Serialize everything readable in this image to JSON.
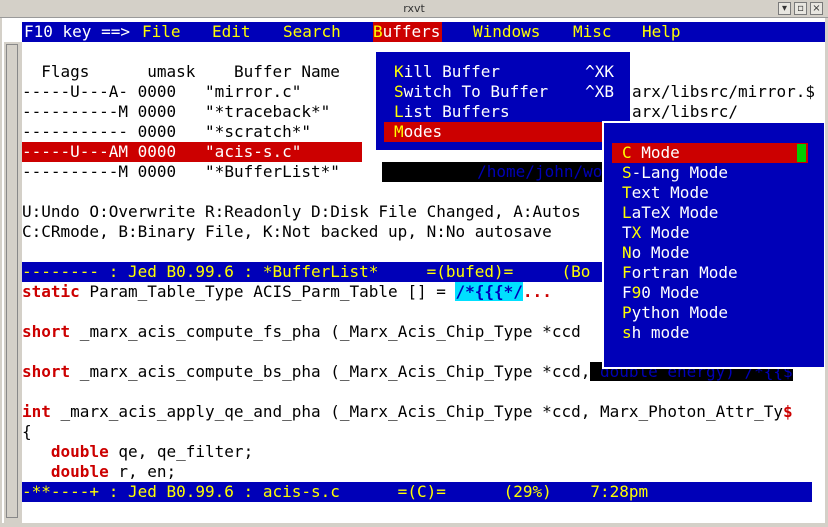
{
  "window": {
    "title": "rxvt"
  },
  "menubar": {
    "prefix": "F10 key ==>",
    "items": [
      {
        "label": "File",
        "hot": "F",
        "rest": "ile"
      },
      {
        "label": "Edit",
        "hot": "E",
        "rest": "dit"
      },
      {
        "label": "Search",
        "hot": "S",
        "rest": "earch"
      },
      {
        "label": "Buffers",
        "hot": "B",
        "rest": "uffers"
      },
      {
        "label": "Windows",
        "hot": "W",
        "rest": "indows"
      },
      {
        "label": "Misc",
        "hot": "M",
        "rest": "isc"
      },
      {
        "label": "Help",
        "hot": "H",
        "rest": "elp"
      }
    ]
  },
  "buffer_list": {
    "headers": {
      "flags": "Flags",
      "umask": "umask",
      "name": "Buffer Name"
    },
    "rows": [
      {
        "flags": "-----U---A-",
        "umask": "0000",
        "name": "\"mirror.c\"",
        "path": "arx/libsrc/mirror.$"
      },
      {
        "flags": "----------M",
        "umask": "0000",
        "name": "\"*traceback*\"",
        "path": "arx/libsrc/"
      },
      {
        "flags": "-----------",
        "umask": "0000",
        "name": "\"*scratch*\"",
        "path": ""
      },
      {
        "flags": "-----U---AM",
        "umask": "0000",
        "name": "\"acis-s.c\"",
        "path": ""
      },
      {
        "flags": "----------M",
        "umask": "0000",
        "name": "\"*BufferList*\"",
        "path": "/home/john/wor"
      }
    ],
    "legend1": "U:Undo O:Overwrite R:Readonly D:Disk File Changed, A:Autos",
    "legend2": "C:CRmode, B:Binary File, K:Not backed up, N:No autosave"
  },
  "status1": "-------- : Jed B0.99.6 : *BufferList*     =(bufed)=     (Bo",
  "code": {
    "line1_kw": "static",
    "line1_rest": " Param_Table_Type ACIS_Parm_Table [] = ",
    "line1_comment": "/*{{{*/",
    "line1_tail": "...",
    "line2_kw": "short",
    "line2_rest": " _marx_acis_compute_fs_pha (_Marx_Acis_Chip_Type *ccd",
    "line3_kw": "short",
    "line3_rest": " _marx_acis_compute_bs_pha (_Marx_Acis_Chip_Type *ccd,",
    "line3_dark": " double energy) /*{{$",
    "line4_kw": "int",
    "line4_rest": " _marx_acis_apply_qe_and_pha (_Marx_Acis_Chip_Type *ccd, Marx_Photon_Attr_Ty",
    "line4_end": "$",
    "line5": "{",
    "line6_kw": "double",
    "line6_rest": " qe, qe_filter;",
    "line7_kw": "double",
    "line7_rest": " r, en;"
  },
  "status2": "-**----+ : Jed B0.99.6 : acis-s.c      =(C)=      (29%)    7:28pm",
  "buffers_menu": {
    "items": [
      {
        "hot": "K",
        "rest": "ill Buffer",
        "key": "^XK"
      },
      {
        "hot": "S",
        "rest": "witch To Buffer",
        "key": "^XB"
      },
      {
        "hot": "L",
        "rest": "ist Buffers",
        "key": ""
      },
      {
        "hot": "M",
        "rest": "odes",
        "key": ">"
      }
    ]
  },
  "modes_menu": {
    "items": [
      {
        "hot": "C",
        "rest": " Mode"
      },
      {
        "hot": "S",
        "rest": "-Lang Mode"
      },
      {
        "hot": "T",
        "rest": "ext Mode"
      },
      {
        "hot": "L",
        "rest": "aTeX Mode"
      },
      {
        "hot": "T",
        "rest": "eX Mode"
      },
      {
        "hot": "N",
        "rest": "o Mode"
      },
      {
        "hot": "F",
        "rest": "ortran Mode"
      },
      {
        "hot": "F",
        "rest": "90 Mode"
      },
      {
        "hot": "P",
        "rest": "ython Mode"
      },
      {
        "hot": "s",
        "rest": "h mode"
      }
    ]
  }
}
